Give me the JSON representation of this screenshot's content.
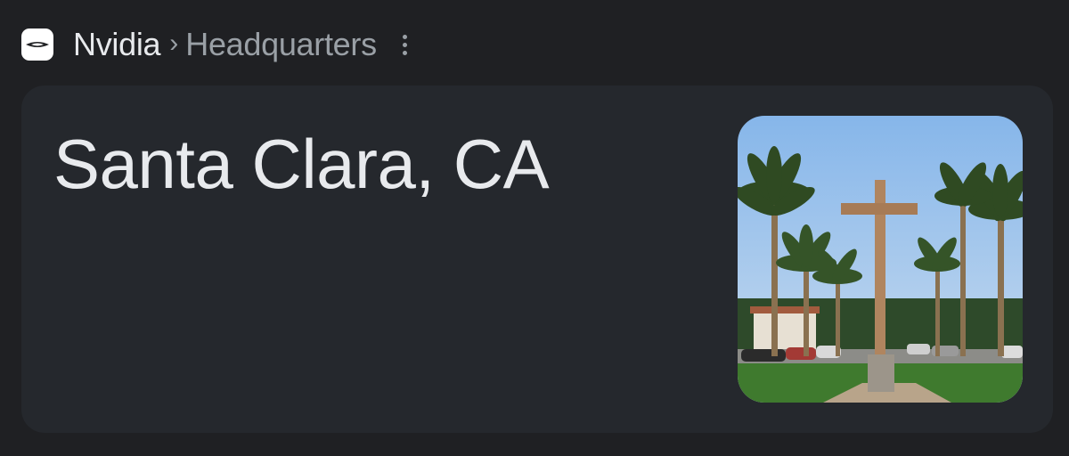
{
  "breadcrumb": {
    "logo_icon": "nvidia-logo-icon",
    "entity": "Nvidia",
    "separator": "›",
    "attribute": "Headquarters",
    "more_icon": "more-vert-icon"
  },
  "answer": {
    "text": "Santa Clara, CA"
  },
  "thumbnail": {
    "icon": "location-photo-image",
    "colors": {
      "sky": "#a9c9ec",
      "grass": "#3f7a2e",
      "cross": "#b0855f",
      "palm_trunk": "#8a7150",
      "palm_leaf": "#2f4a22"
    }
  },
  "colors": {
    "page_bg": "#1f2023",
    "card_bg": "#25282d",
    "primary_text": "#e8eaed",
    "secondary_text": "#9aa0a6"
  }
}
